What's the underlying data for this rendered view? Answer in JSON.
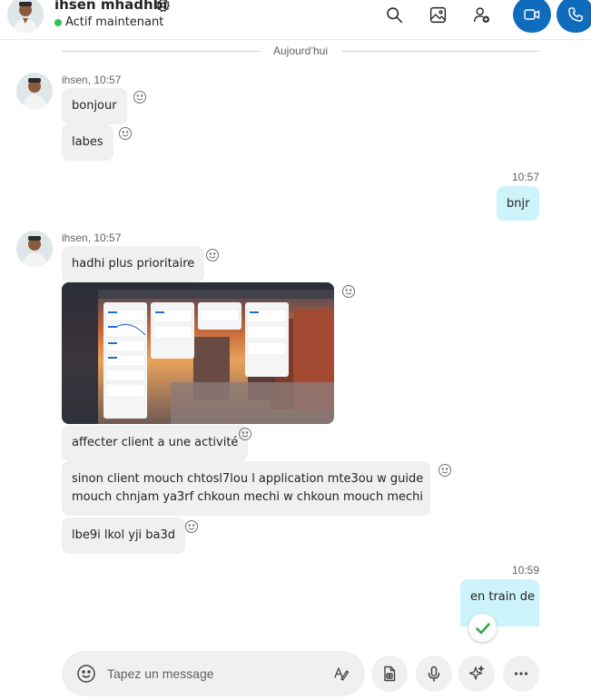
{
  "header": {
    "contact_name": "ihsen mhadhbi",
    "status": "Actif maintenant",
    "status_color": "#2fc05a",
    "icons": [
      "settings-icon",
      "search-icon",
      "gallery-icon",
      "add-person-icon",
      "video-call-icon",
      "audio-call-icon"
    ],
    "accent_color": "#0f6cbd"
  },
  "chat": {
    "date_divider": "Aujourd’hui",
    "groups": [
      {
        "sender": "ihsen, 10:57",
        "messages": [
          "bonjour",
          "labes"
        ]
      },
      {
        "time": "10:57",
        "messages": [
          "bnjr"
        ]
      },
      {
        "sender": "ihsen, 10:57",
        "messages": [
          "hadhi plus prioritaire",
          "affecter client a une activité",
          "sinon client mouch chtosl7lou l application mte3ou w guide",
          "mouch chnjam ya3rf chkoun mechi w chkoun mouch mechi",
          "lbe9i lkol yji ba3d"
        ],
        "image": "screenshot-image"
      },
      {
        "time": "10:59",
        "messages": [
          "en train de"
        ],
        "read_indicator": "check-icon"
      }
    ],
    "outgoing_bubble_color": "#cdf3fb",
    "incoming_bubble_color": "#f0f0f0"
  },
  "composer": {
    "placeholder": "Tapez un message",
    "icons": [
      "emoji-icon",
      "format-icon",
      "attach-file-icon",
      "microphone-icon",
      "sparkle-icon",
      "more-icon"
    ]
  }
}
